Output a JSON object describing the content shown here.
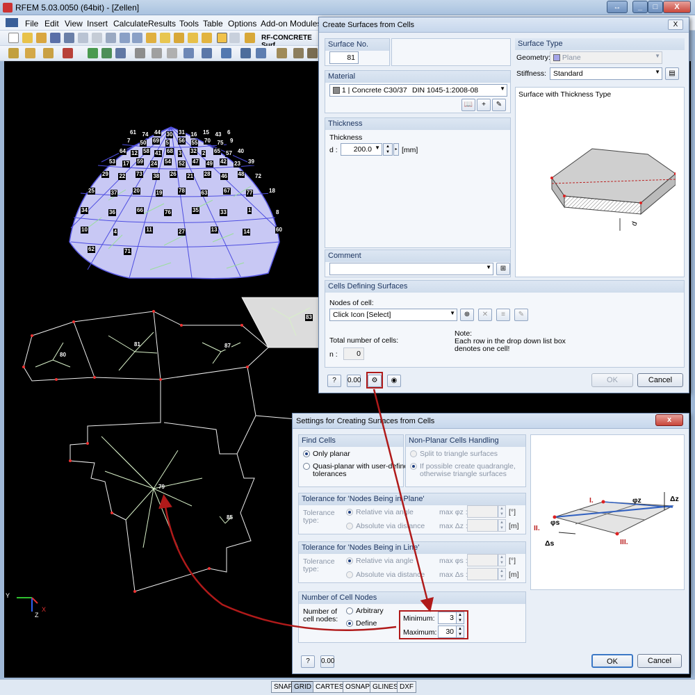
{
  "app": {
    "title": "RFEM 5.03.0050 (64bit) - [Zellen]",
    "menu": [
      "File",
      "Edit",
      "View",
      "Insert",
      "Calculate",
      "Results",
      "Tools",
      "Table",
      "Options",
      "Add-on Modules"
    ],
    "addon_label": "RF-CONCRETE Surf",
    "window_buttons": [
      "↔",
      "_",
      "□",
      "X"
    ]
  },
  "viewport": {
    "dome_cells": [
      "61",
      "74",
      "44",
      "30",
      "31",
      "16",
      "15",
      "43",
      "6",
      "7",
      "50",
      "69",
      "5",
      "56",
      "55",
      "70",
      "75",
      "9",
      "64",
      "12",
      "58",
      "41",
      "68",
      "3",
      "32",
      "2",
      "65",
      "57",
      "40",
      "53",
      "17",
      "59",
      "24",
      "54",
      "52",
      "47",
      "49",
      "42",
      "23",
      "39",
      "29",
      "22",
      "73",
      "38",
      "26",
      "21",
      "28",
      "46",
      "48",
      "72",
      "25",
      "37",
      "20",
      "19",
      "78",
      "63",
      "67",
      "77",
      "18",
      "34",
      "36",
      "66",
      "76",
      "35",
      "33",
      "1",
      "8",
      "10",
      "4",
      "11",
      "27",
      "13",
      "14",
      "60",
      "62",
      "71"
    ],
    "floor_cells": [
      "83",
      "81",
      "80",
      "87",
      "79",
      "85"
    ],
    "axis_labels": [
      "Y",
      "X",
      "Z"
    ]
  },
  "statusbar": [
    "SNAP",
    "GRID",
    "CARTES",
    "OSNAP",
    "GLINES",
    "DXF"
  ],
  "dialog1": {
    "title": "Create Surfaces from Cells",
    "close": "X",
    "surface_no_h": "Surface No.",
    "surface_no": "81",
    "surface_type_h": "Surface Type",
    "geometry_lbl": "Geometry:",
    "geometry_val": "Plane",
    "stiffness_lbl": "Stiffness:",
    "stiffness_val": "Standard",
    "material_h": "Material",
    "material_no": "1",
    "material_name": "Concrete C30/37",
    "material_norm": "DIN 1045-1:2008-08",
    "thickness_h": "Thickness",
    "thickness_lbl": "Thickness",
    "d_lbl": "d :",
    "d_val": "200.0",
    "d_unit": "[mm]",
    "preview_title": "Surface with Thickness Type",
    "preview_d": "d",
    "comment_h": "Comment",
    "cells_h": "Cells Defining Surfaces",
    "nodes_lbl": "Nodes of cell:",
    "nodes_val": "Click Icon [Select]",
    "total_lbl": "Total number of cells:",
    "n_lbl": "n :",
    "n_val": "0",
    "note_title": "Note:",
    "note_text1": "Each row in the drop down list box",
    "note_text2": "denotes one cell!",
    "ok": "OK",
    "cancel": "Cancel"
  },
  "dialog2": {
    "title": "Settings for Creating Surfaces from Cells",
    "close": "x",
    "find_h": "Find Cells",
    "only_planar": "Only planar",
    "quasi_planar1": "Quasi-planar with user-defined",
    "quasi_planar2": "tolerances",
    "nonplanar_h": "Non-Planar Cells Handling",
    "split": "Split to triangle surfaces",
    "quad1": "If possible create quadrangle,",
    "quad2": "otherwise triangle surfaces",
    "tol_plane_h": "Tolerance for 'Nodes Being in Plane'",
    "tol_line_h": "Tolerance for 'Nodes Being in Line'",
    "tol_type1": "Tolerance",
    "tol_type2": "type:",
    "rel_angle": "Relative via angle",
    "abs_dist": "Absolute via distance",
    "max_phi_z": "max φz :",
    "max_delta_z": "max Δz :",
    "max_phi_s": "max φs :",
    "max_delta_s": "max Δs :",
    "unit_deg": "[°]",
    "unit_m": "[m]",
    "cell_nodes_h": "Number of Cell Nodes",
    "num_of1": "Number of",
    "num_of2": "cell nodes:",
    "arbitrary": "Arbitrary",
    "define": "Define",
    "min_lbl": "Minimum:",
    "min_val": "3",
    "max_lbl": "Maximum:",
    "max_val": "30",
    "diagram": {
      "p1": "I.",
      "p2": "II.",
      "p3": "III.",
      "phi_z": "φz",
      "delta_z": "Δz",
      "phi_s": "φs",
      "delta_s": "Δs"
    },
    "ok": "OK",
    "cancel": "Cancel"
  }
}
